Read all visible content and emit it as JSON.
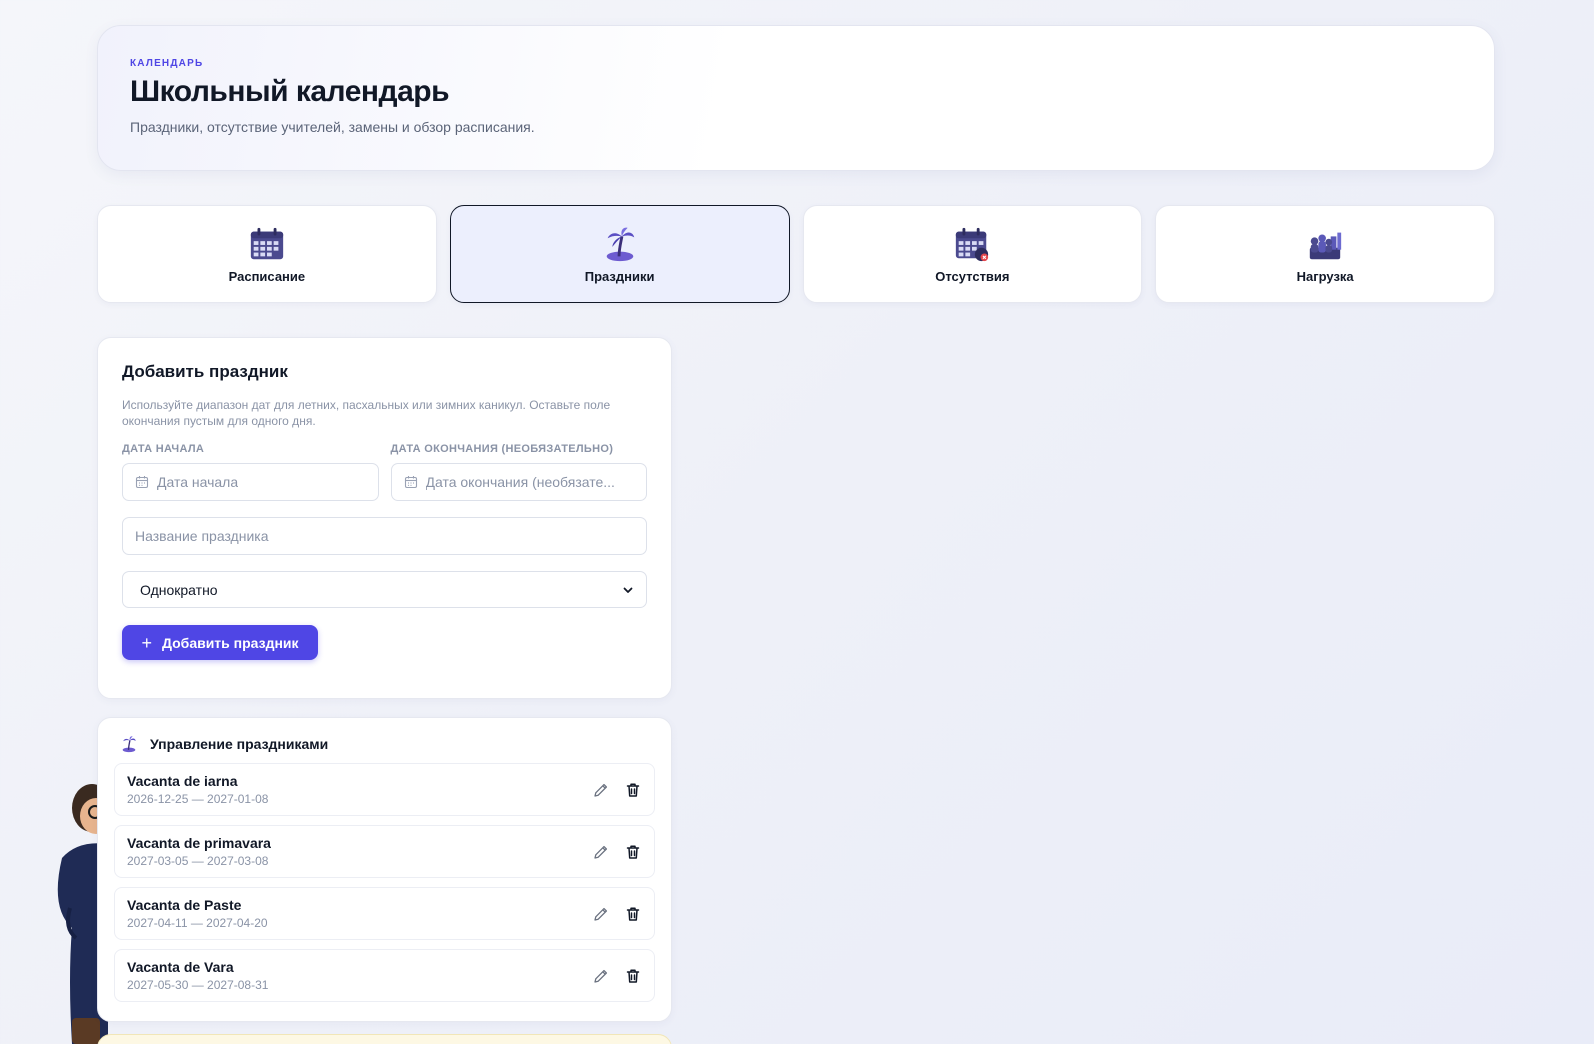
{
  "header": {
    "eyebrow": "КАЛЕНДАРЬ",
    "title": "Школьный календарь",
    "subtitle": "Праздники, отсутствие учителей, замены и обзор расписания."
  },
  "tabs": [
    {
      "label": "Расписание",
      "icon": "calendar-grid-icon",
      "active": false
    },
    {
      "label": "Праздники",
      "icon": "palm-island-icon",
      "active": true
    },
    {
      "label": "Отсутствия",
      "icon": "calendar-absence-icon",
      "active": false
    },
    {
      "label": "Нагрузка",
      "icon": "people-chart-icon",
      "active": false
    }
  ],
  "add_form": {
    "title": "Добавить праздник",
    "description": "Используйте диапазон дат для летних, пасхальных или зимних каникул. Оставьте поле окончания пустым для одного дня.",
    "start_label": "Дата начала",
    "start_placeholder": "Дата начала",
    "end_label": "Дата окончания (необязательно)",
    "end_placeholder": "Дата окончания (необязате...",
    "name_placeholder": "Название праздника",
    "recurrence_value": "Однократно",
    "submit_label": "Добавить праздник"
  },
  "manage": {
    "title": "Управление праздниками",
    "items": [
      {
        "name": "Vacanta de iarna",
        "dates": "2026-12-25 — 2027-01-08"
      },
      {
        "name": "Vacanta de primavara",
        "dates": "2027-03-05 — 2027-03-08"
      },
      {
        "name": "Vacanta de Paste",
        "dates": "2027-04-11 — 2027-04-20"
      },
      {
        "name": "Vacanta de Vara",
        "dates": "2027-05-30 — 2027-08-31"
      }
    ]
  },
  "colors": {
    "accent": "#4f46e5",
    "active_tab_bg": "#eceffd"
  }
}
